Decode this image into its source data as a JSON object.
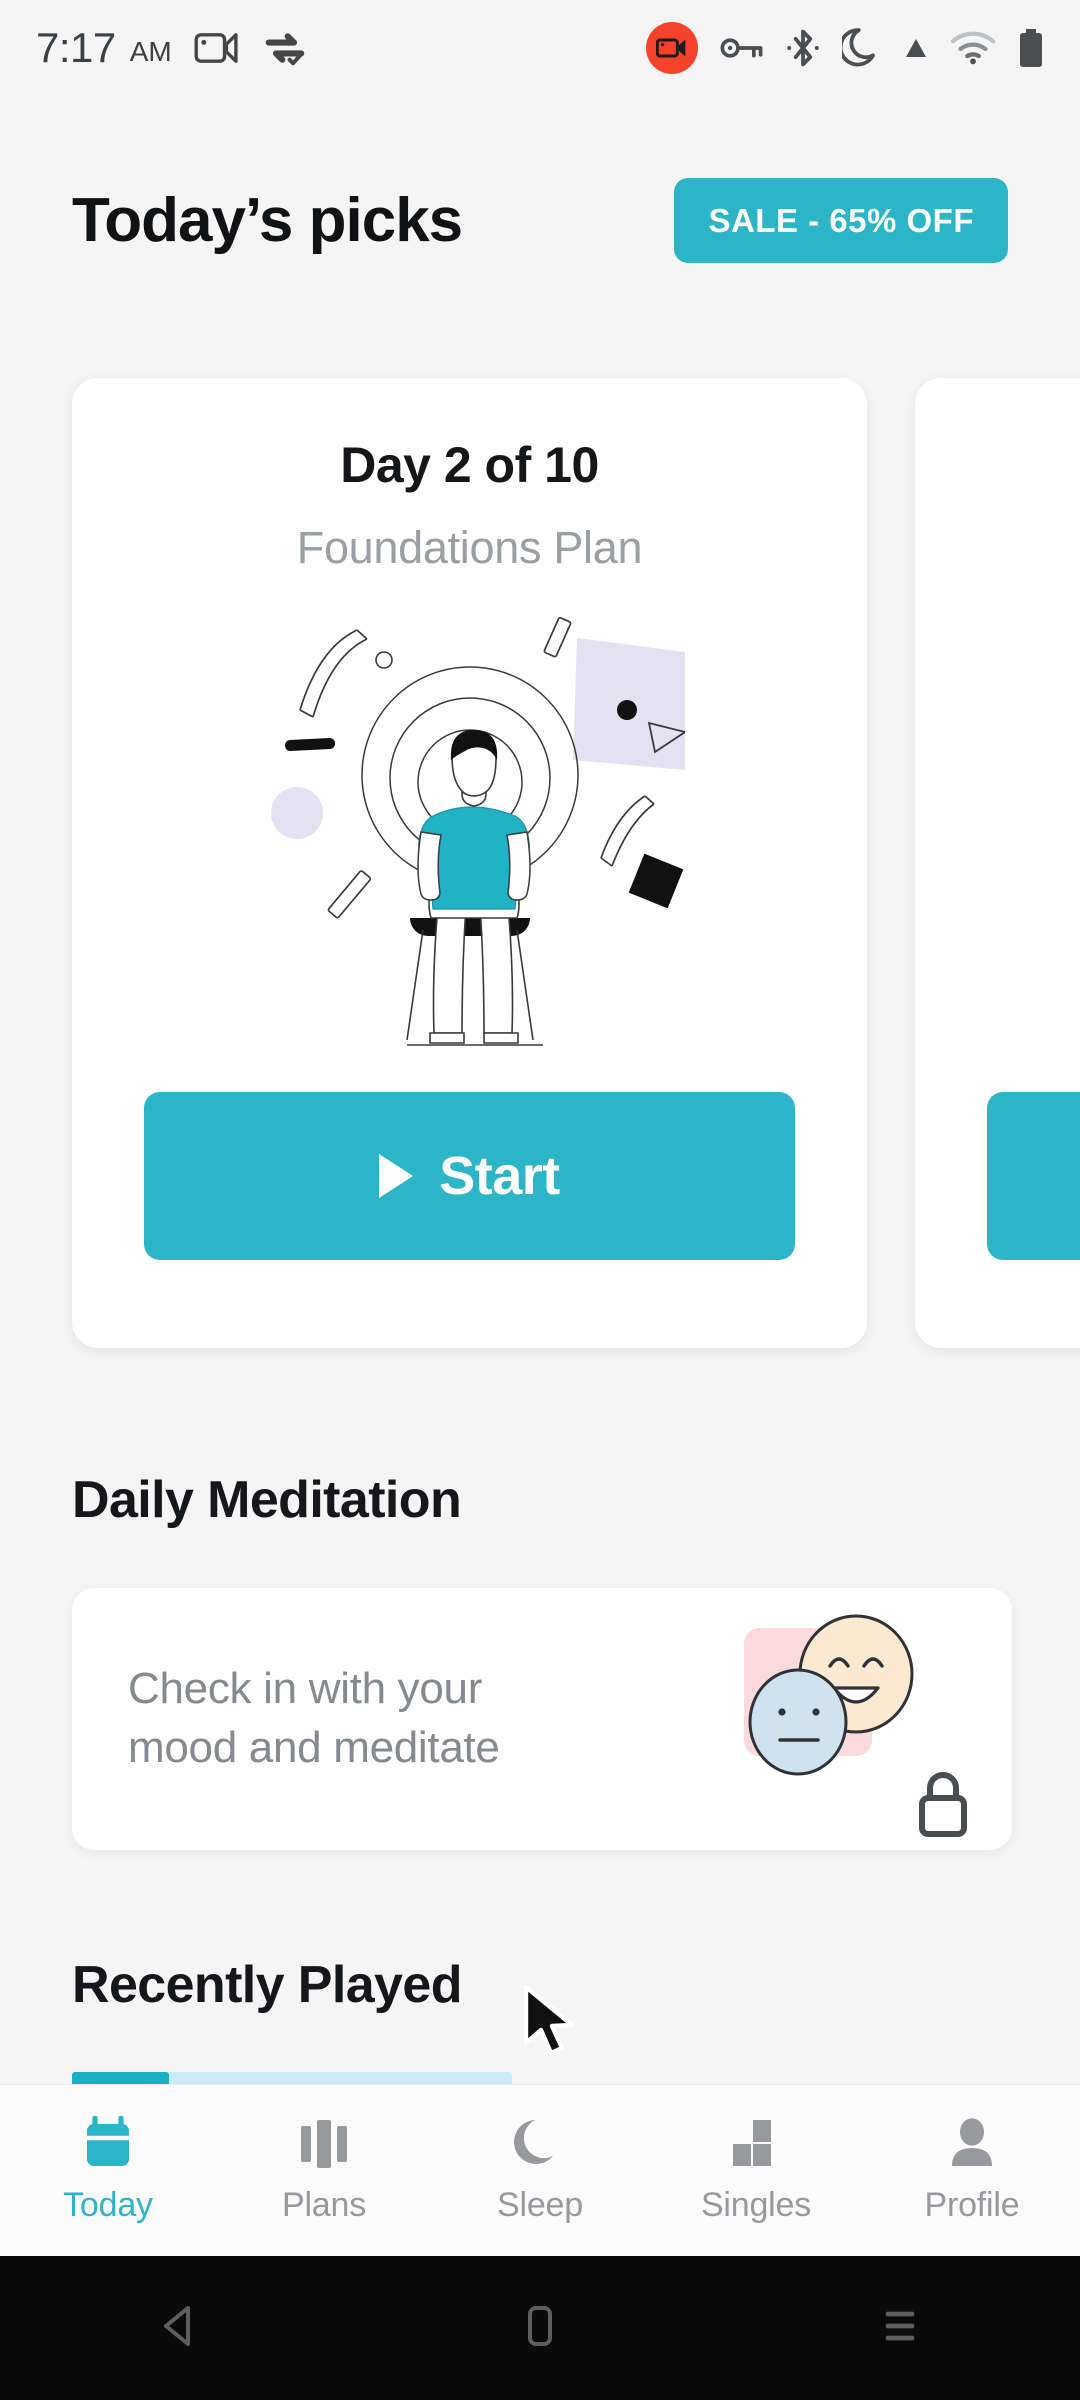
{
  "status_bar": {
    "time": "7:17",
    "ampm": "AM",
    "icons_left": [
      "screen-record-video-icon",
      "vpn-data-transfer-icon"
    ],
    "icons_right": [
      "screen-recording-badge-icon",
      "vpn-key-icon",
      "bluetooth-icon",
      "do-not-disturb-moon-icon",
      "signal-triangle-icon",
      "wifi-icon",
      "battery-icon"
    ],
    "recording_badge_color": "#f4432a"
  },
  "header": {
    "title": "Today’s picks",
    "sale_label": "SALE - 65% OFF"
  },
  "theme": {
    "accent": "#2cb5c7",
    "accent_dark": "#19b0c6",
    "background": "#f5f5f6",
    "card": "#ffffff",
    "muted_text": "#9b9ea3"
  },
  "carousel": {
    "cards": [
      {
        "title": "Day 2 of 10",
        "subtitle": "Foundations Plan",
        "button_label": "Start",
        "illustration": "meditating-person-illustration"
      },
      {
        "title": "",
        "subtitle": "",
        "button_label": "",
        "illustration": ""
      }
    ]
  },
  "daily_meditation": {
    "section_title": "Daily Meditation",
    "card_text_line1": "Check in with your",
    "card_text_line2": "mood and meditate",
    "locked": true,
    "art": {
      "neutral_face": "neutral-face-icon",
      "happy_face": "happy-face-icon",
      "lock": "lock-icon"
    }
  },
  "recently_played": {
    "section_title": "Recently Played",
    "progress_percent": 22
  },
  "bottom_nav": {
    "items": [
      {
        "label": "Today",
        "icon": "calendar-icon",
        "active": true
      },
      {
        "label": "Plans",
        "icon": "columns-icon",
        "active": false
      },
      {
        "label": "Sleep",
        "icon": "moon-icon",
        "active": false
      },
      {
        "label": "Singles",
        "icon": "blocks-icon",
        "active": false
      },
      {
        "label": "Profile",
        "icon": "person-icon",
        "active": false
      }
    ]
  },
  "android_nav": {
    "back": "back-triangle-icon",
    "home": "home-square-icon",
    "recents": "recents-lines-icon"
  },
  "cursor": {
    "type": "mouse-pointer-arrow"
  }
}
